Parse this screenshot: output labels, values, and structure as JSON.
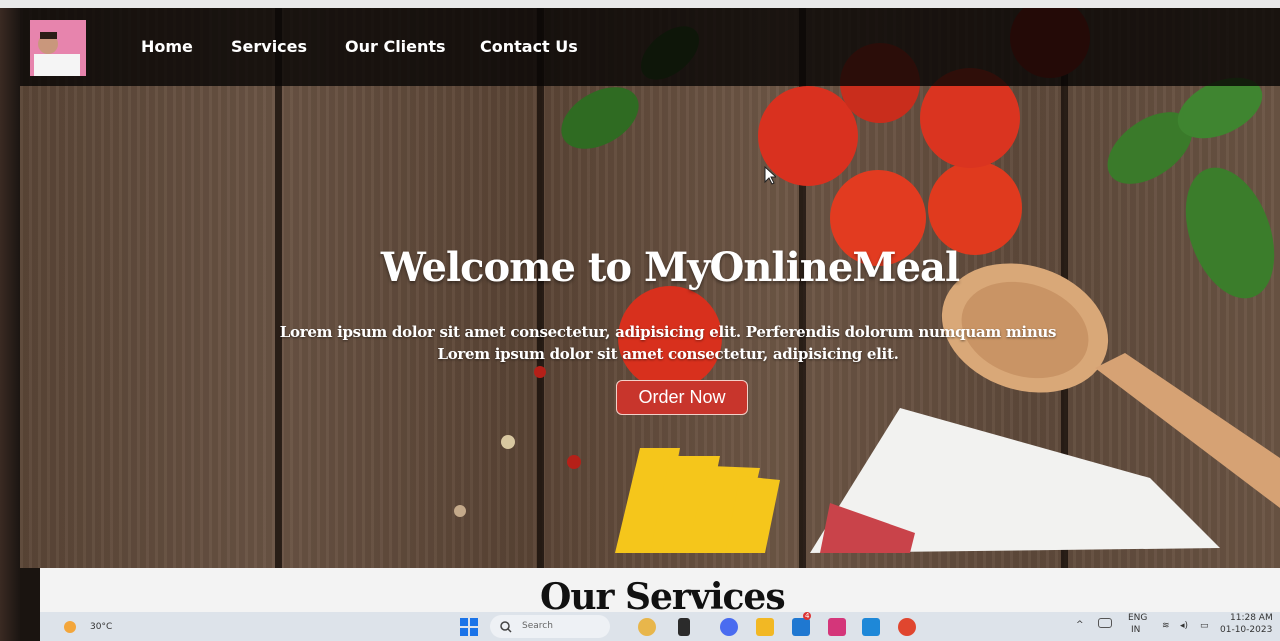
{
  "nav": {
    "items": [
      {
        "label": "Home"
      },
      {
        "label": "Services"
      },
      {
        "label": "Our Clients"
      },
      {
        "label": "Contact Us"
      }
    ]
  },
  "hero": {
    "title": "Welcome to MyOnlineMeal",
    "line1": "Lorem ipsum dolor sit amet consectetur, adipisicing elit. Perferendis dolorum numquam minus",
    "line2": "Lorem ipsum dolor sit amet consectetur, adipisicing elit.",
    "cta_label": "Order Now"
  },
  "services": {
    "title": "Our Services"
  },
  "taskbar": {
    "weather": "30°C",
    "search_placeholder": "Search",
    "lang_line1": "ENG",
    "lang_line2": "IN",
    "time": "11:28 AM",
    "date": "01-10-2023",
    "mail_badge": "4"
  },
  "colors": {
    "accent": "#c8352c",
    "navbar_bg": "#080605",
    "taskbar_bg": "#dde3ea"
  }
}
